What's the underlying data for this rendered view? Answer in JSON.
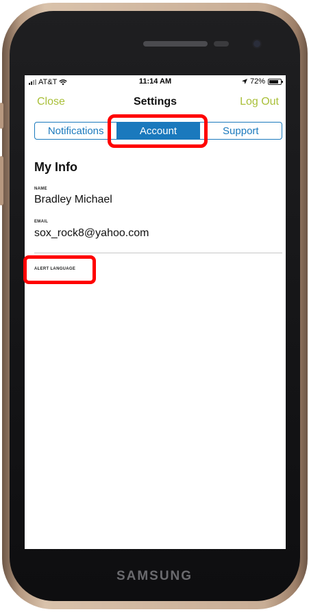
{
  "status_bar": {
    "carrier": "AT&T",
    "time": "11:14 AM",
    "battery": "72%",
    "icons": {
      "signal": "signal-bars-icon",
      "wifi": "wifi-icon",
      "location": "location-arrow-icon",
      "battery": "battery-icon"
    }
  },
  "nav": {
    "close_label": "Close",
    "title": "Settings",
    "logout_label": "Log Out"
  },
  "tabs": [
    {
      "label": "Notifications",
      "active": false
    },
    {
      "label": "Account",
      "active": true
    },
    {
      "label": "Support",
      "active": false
    }
  ],
  "section": {
    "title": "My Info",
    "name_label": "NAME",
    "name_value": "Bradley Michael",
    "email_label": "EMAIL",
    "email_value": "sox_rock8@yahoo.com",
    "alert_language_label": "ALERT LANGUAGE"
  },
  "device": {
    "brand": "SAMSUNG"
  },
  "colors": {
    "accent_green": "#a9bf38",
    "tab_blue": "#1a79bd",
    "highlight_red": "#ff0000"
  }
}
